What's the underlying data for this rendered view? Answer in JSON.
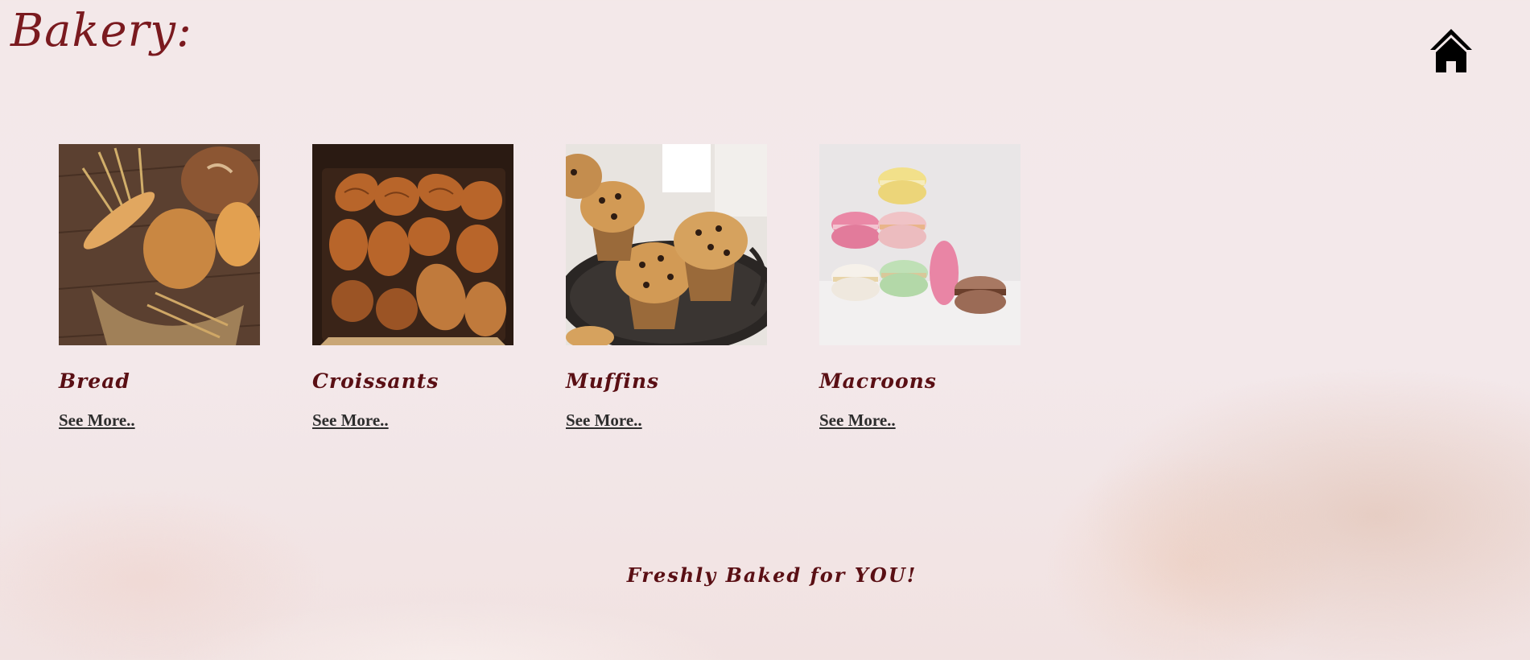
{
  "header": {
    "brand": "Bakery:",
    "home_icon": "home-icon"
  },
  "products": [
    {
      "name": "Bread",
      "link_label": "See More..",
      "image": "bread-photo"
    },
    {
      "name": "Croissants",
      "link_label": "See More..",
      "image": "croissants-photo"
    },
    {
      "name": "Muffins",
      "link_label": "See More..",
      "image": "muffins-photo"
    },
    {
      "name": "Macroons",
      "link_label": "See More..",
      "image": "macarons-photo"
    }
  ],
  "footer": {
    "tagline": "Freshly Baked for YOU!"
  },
  "colors": {
    "brand": "#7a1a1f",
    "product_title": "#5a0f14",
    "link": "#2d2d2d",
    "background": "#f3e8e9"
  }
}
